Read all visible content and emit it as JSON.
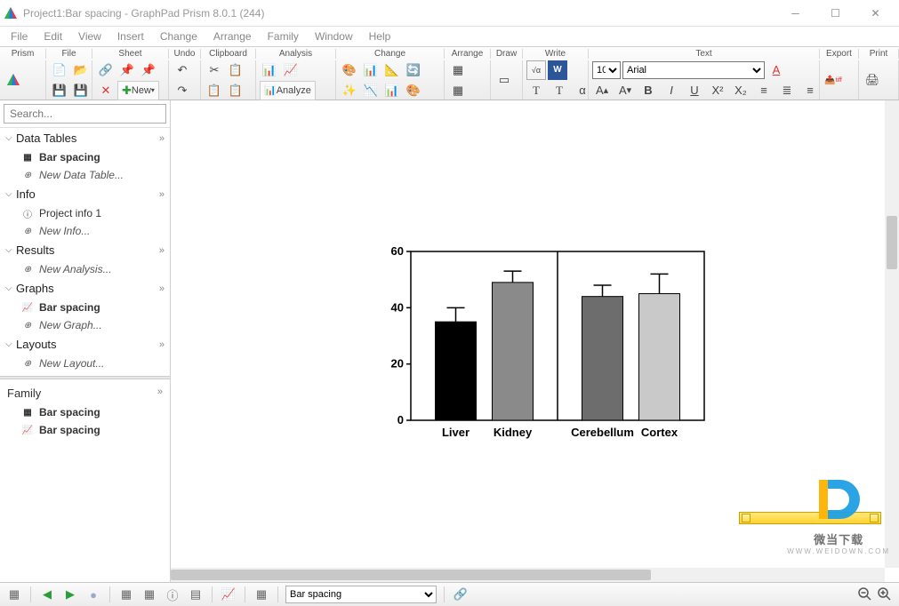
{
  "window": {
    "title": "Project1:Bar spacing - GraphPad Prism 8.0.1 (244)"
  },
  "menu": [
    "File",
    "Edit",
    "View",
    "Insert",
    "Change",
    "Arrange",
    "Family",
    "Window",
    "Help"
  ],
  "toolbar_groups": [
    "Prism",
    "File",
    "Sheet",
    "Undo",
    "Clipboard",
    "Analysis",
    "Change",
    "Arrange",
    "Draw",
    "Write",
    "Text",
    "Export",
    "Print"
  ],
  "font": {
    "size": "10",
    "name": "Arial"
  },
  "toolbar": {
    "new": "New",
    "analyze": "Analyze"
  },
  "search": {
    "placeholder": "Search..."
  },
  "sidebar": {
    "sections": [
      {
        "label": "Data Tables",
        "items": [
          {
            "label": "Bar spacing",
            "bold": true,
            "icon": "grid"
          },
          {
            "label": "New Data Table...",
            "italic": true,
            "icon": "plus"
          }
        ]
      },
      {
        "label": "Info",
        "items": [
          {
            "label": "Project info 1",
            "icon": "info"
          },
          {
            "label": "New Info...",
            "italic": true,
            "icon": "plus"
          }
        ]
      },
      {
        "label": "Results",
        "items": [
          {
            "label": "New Analysis...",
            "italic": true,
            "icon": "plus"
          }
        ]
      },
      {
        "label": "Graphs",
        "items": [
          {
            "label": "Bar spacing",
            "bold": true,
            "icon": "chart"
          },
          {
            "label": "New Graph...",
            "italic": true,
            "icon": "plus"
          }
        ]
      },
      {
        "label": "Layouts",
        "items": [
          {
            "label": "New Layout...",
            "italic": true,
            "icon": "plus"
          }
        ]
      }
    ],
    "family": {
      "label": "Family",
      "items": [
        {
          "label": "Bar spacing",
          "icon": "grid"
        },
        {
          "label": "Bar spacing",
          "icon": "chart"
        }
      ]
    }
  },
  "status": {
    "graph_name": "Bar spacing"
  },
  "watermark": {
    "text": "微当下载",
    "url": "WWW.WEIDOWN.COM"
  },
  "chart_data": {
    "type": "bar",
    "categories": [
      "Liver",
      "Kidney",
      "Cerebellum",
      "Cortex"
    ],
    "values": [
      35,
      49,
      44,
      45
    ],
    "errors": [
      5,
      4,
      4,
      7
    ],
    "colors": [
      "#000000",
      "#8a8a8a",
      "#6d6d6d",
      "#c9c9c9"
    ],
    "ylim": [
      0,
      60
    ],
    "yticks": [
      0,
      20,
      40,
      60
    ],
    "group_split": 2,
    "title": "",
    "xlabel": "",
    "ylabel": ""
  }
}
